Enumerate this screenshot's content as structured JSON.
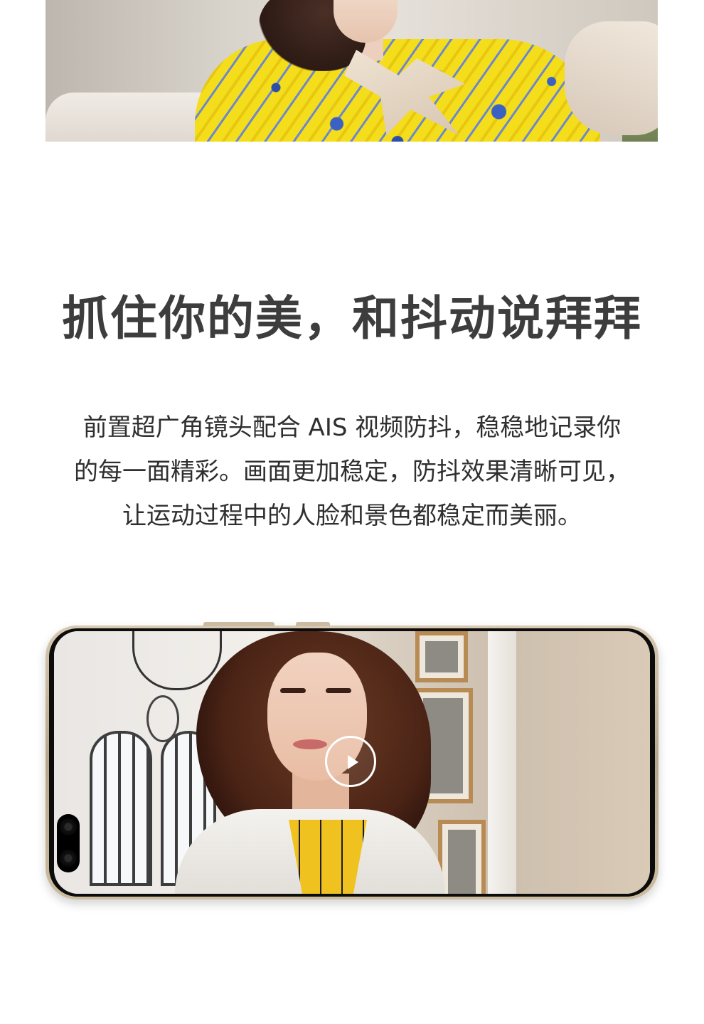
{
  "hero": {
    "image_alt": "模特身穿黄色蓝纹印花连衣裙"
  },
  "section": {
    "title": "抓住你的美，和抖动说拜拜",
    "body_lines": [
      "前置超广角镜头配合 AIS 视频防抖，稳稳地记录你",
      "的每一面精彩。画面更加稳定，防抖效果清晰可见，",
      "让运动过程中的人脸和景色都稳定而美丽。"
    ]
  },
  "video": {
    "play_icon": "play-icon"
  },
  "colors": {
    "title": "#3d3d3d",
    "body": "#2f2f2f",
    "background": "#ffffff",
    "phone_frame": "#b8a688"
  }
}
